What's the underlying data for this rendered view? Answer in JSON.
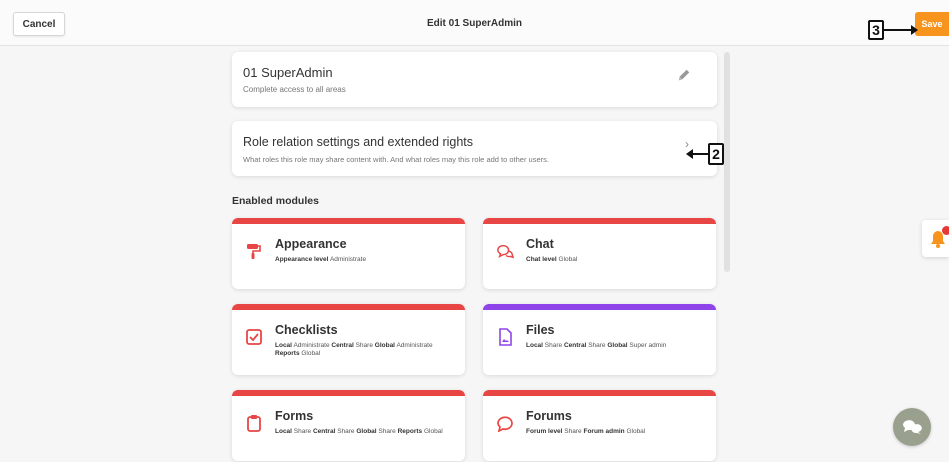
{
  "header": {
    "cancel_label": "Cancel",
    "title": "Edit 01 SuperAdmin",
    "save_label": "Save",
    "callout_save": "3"
  },
  "role": {
    "name": "01 SuperAdmin",
    "description": "Complete access to all areas",
    "edit_icon": "pencil-icon"
  },
  "relations": {
    "title": "Role relation settings and extended rights",
    "description": "What roles this role may share content with. And what roles may this role add to other users.",
    "callout": "2"
  },
  "modules_heading": "Enabled modules",
  "modules": [
    {
      "title": "Appearance",
      "icon": "paint-roller-icon",
      "accent": "#e84545",
      "desc": [
        {
          "k": "Appearance level",
          "v": "Administrate"
        }
      ]
    },
    {
      "title": "Chat",
      "icon": "chat-bubbles-icon",
      "accent": "#e84545",
      "desc": [
        {
          "k": "Chat level",
          "v": "Global"
        }
      ]
    },
    {
      "title": "Checklists",
      "icon": "checkbox-icon",
      "accent": "#e84545",
      "desc": [
        {
          "k": "Local",
          "v": "Administrate"
        },
        {
          "k": "Central",
          "v": "Share"
        },
        {
          "k": "Global",
          "v": "Administrate"
        },
        {
          "k": "Reports",
          "v": "Global"
        }
      ]
    },
    {
      "title": "Files",
      "icon": "file-image-icon",
      "accent": "#8e44e8",
      "desc": [
        {
          "k": "Local",
          "v": "Share"
        },
        {
          "k": "Central",
          "v": "Share"
        },
        {
          "k": "Global",
          "v": "Super admin"
        }
      ]
    },
    {
      "title": "Forms",
      "icon": "clipboard-icon",
      "accent": "#e84545",
      "desc": [
        {
          "k": "Local",
          "v": "Share"
        },
        {
          "k": "Central",
          "v": "Share"
        },
        {
          "k": "Global",
          "v": "Share"
        },
        {
          "k": "Reports",
          "v": "Global"
        }
      ]
    },
    {
      "title": "Forums",
      "icon": "speech-bubble-icon",
      "accent": "#e84545",
      "desc": [
        {
          "k": "Forum level",
          "v": "Share"
        },
        {
          "k": "Forum admin",
          "v": "Global"
        }
      ]
    }
  ],
  "colors": {
    "save": "#f7941d",
    "module_red": "#e84545",
    "module_purple": "#8e44e8"
  }
}
